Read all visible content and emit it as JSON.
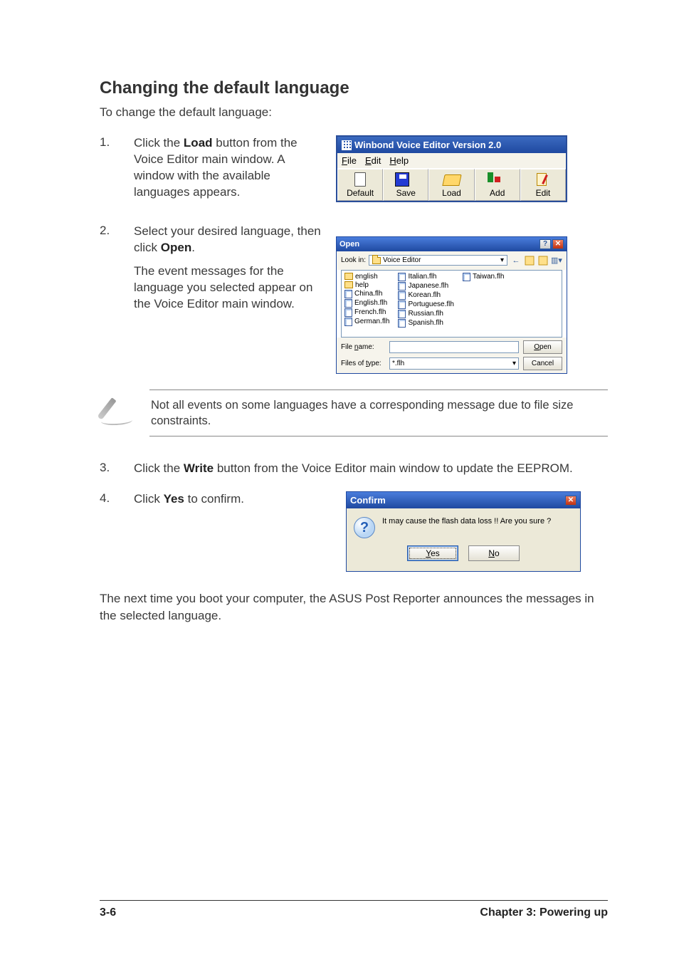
{
  "heading": "Changing the default language",
  "intro": "To change the default language:",
  "steps": {
    "s1": {
      "num": "1.",
      "text_a": "Click the ",
      "bold": "Load",
      "text_b": " button from the Voice Editor main window. A window with the available languages appears."
    },
    "s2": {
      "num": "2.",
      "text_a": "Select your desired language, then click ",
      "bold": "Open",
      "text_b": ".",
      "para2": "The event messages for the language you selected appear on the Voice Editor main window."
    },
    "s3": {
      "num": "3.",
      "text_a": "Click the ",
      "bold": "Write",
      "text_b": " button from the Voice Editor main window to update the EEPROM."
    },
    "s4": {
      "num": "4.",
      "text_a": "Click ",
      "bold": "Yes",
      "text_b": " to confirm."
    }
  },
  "winbond": {
    "title": "Winbond Voice Editor  Version 2.0",
    "menu": {
      "file": "File",
      "edit": "Edit",
      "help": "Help"
    },
    "buttons": {
      "default": "Default",
      "save": "Save",
      "load": "Load",
      "add": "Add",
      "edit": "Edit"
    }
  },
  "open_dialog": {
    "title": "Open",
    "lookin_label": "Look in:",
    "lookin_value": "Voice Editor",
    "files": {
      "col1": [
        "english",
        "help",
        "China.flh",
        "English.flh",
        "French.flh",
        "German.flh"
      ],
      "col2": [
        "Italian.flh",
        "Japanese.flh",
        "Korean.flh",
        "Portuguese.flh",
        "Russian.flh",
        "Spanish.flh"
      ],
      "col3": [
        "Taiwan.flh"
      ]
    },
    "filename_label": "File name:",
    "filename_value": "",
    "filetype_label": "Files of type:",
    "filetype_value": "*.flh",
    "open_btn": "Open",
    "cancel_btn": "Cancel"
  },
  "note": "Not all events on some languages have a corresponding message due to file size constraints.",
  "confirm": {
    "title": "Confirm",
    "message": "It may cause the flash data loss !!  Are you sure ?",
    "yes": "Yes",
    "no": "No"
  },
  "final": "The next time you boot your computer, the ASUS Post Reporter announces the messages in the selected language.",
  "footer": {
    "left": "3-6",
    "right": "Chapter 3: Powering up"
  }
}
